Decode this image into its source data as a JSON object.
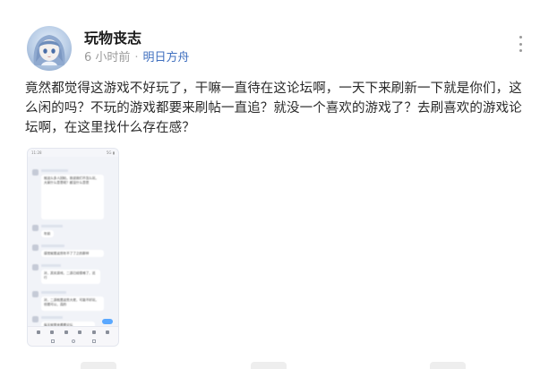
{
  "post": {
    "author": "玩物丧志",
    "time": "6 小时前",
    "separator": "·",
    "board": "明日方舟",
    "content": "竟然都觉得这游戏不好玩了，干嘛一直待在这论坛啊，一天下来刷新一下就是你们，这么闲的吗？不玩的游戏都要来刷帖一直追？就没一个喜欢的游戏了？去刷喜欢的游戏论坛啊，在这里找什么存在感？",
    "avatar_icon": "anime-girl-avatar-icon",
    "more_icon": "more-vertical-icon"
  },
  "attachment": {
    "type": "chat-screenshot",
    "status_time": "11:28",
    "status_right": "5G ▮",
    "bubble_1_text": "就这么多人回帖，我说我们不怎么玩，大家什么意思呢？都没什么意思",
    "bubble_2_text": "年前",
    "bubble_3_text": "感觉就是这些年不了了之的那样",
    "bubble_4_text": "对，其实游戏，二游已经很难了，还行",
    "bubble_5_text": "对，二游就是这些大佬，可能不好玩，但是可以，真的",
    "bubble_6_text": "每天就是来看看论坛"
  },
  "colors": {
    "link": "#3f6fbf",
    "meta": "#9a9a9a",
    "text": "#2a2a2a"
  }
}
